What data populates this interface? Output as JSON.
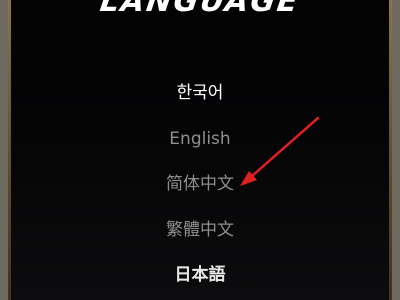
{
  "title": "LANGUAGE",
  "languages": [
    {
      "label": "한국어",
      "selected": true
    },
    {
      "label": "English",
      "selected": false
    },
    {
      "label": "简体中文",
      "selected": false
    },
    {
      "label": "繁體中文",
      "selected": false
    },
    {
      "label": "日本語",
      "selected": false
    }
  ],
  "colors": {
    "selected_text": "#ffffff",
    "unselected_text": "#8e8e8e",
    "annotation_arrow": "#e02020",
    "frame_border": "#8a7548"
  },
  "annotation": {
    "icon": "red-arrow-icon",
    "points_to": "简体中文"
  }
}
